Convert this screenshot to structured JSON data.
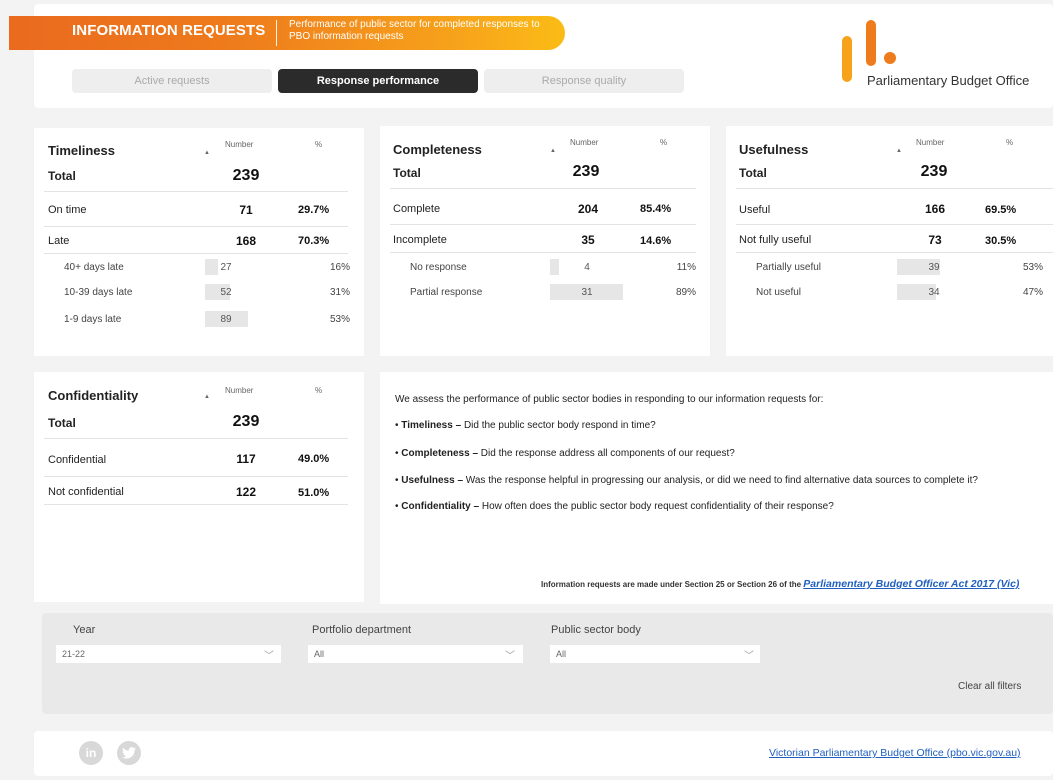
{
  "header": {
    "title": "INFORMATION REQUESTS",
    "subtitle": "Performance of public sector for completed responses to PBO information requests",
    "logo_text": "Parliamentary Budget Office",
    "brand_colors": {
      "orange": "#ee7b1c",
      "amber": "#f7a21b"
    }
  },
  "tabs": [
    {
      "label": "Active requests",
      "active": false
    },
    {
      "label": "Response performance",
      "active": true
    },
    {
      "label": "Response quality",
      "active": false
    }
  ],
  "col_headers": {
    "number": "Number",
    "percent": "%"
  },
  "timeliness": {
    "title": "Timeliness",
    "total_label": "Total",
    "total": "239",
    "rows": [
      {
        "label": "On time",
        "number": "71",
        "pct": "29.7%"
      },
      {
        "label": "Late",
        "number": "168",
        "pct": "70.3%"
      }
    ],
    "subrows": [
      {
        "label": "40+ days late",
        "number": "27",
        "pct": "16%",
        "share": 0.16
      },
      {
        "label": "10-39 days late",
        "number": "52",
        "pct": "31%",
        "share": 0.31
      },
      {
        "label": "1-9 days late",
        "number": "89",
        "pct": "53%",
        "share": 0.53
      }
    ]
  },
  "completeness": {
    "title": "Completeness",
    "total_label": "Total",
    "total": "239",
    "rows": [
      {
        "label": "Complete",
        "number": "204",
        "pct": "85.4%"
      },
      {
        "label": "Incomplete",
        "number": "35",
        "pct": "14.6%"
      }
    ],
    "subrows": [
      {
        "label": "No response",
        "number": "4",
        "pct": "11%",
        "share": 0.11
      },
      {
        "label": "Partial response",
        "number": "31",
        "pct": "89%",
        "share": 0.89
      }
    ]
  },
  "usefulness": {
    "title": "Usefulness",
    "total_label": "Total",
    "total": "239",
    "rows": [
      {
        "label": "Useful",
        "number": "166",
        "pct": "69.5%"
      },
      {
        "label": "Not fully useful",
        "number": "73",
        "pct": "30.5%"
      }
    ],
    "subrows": [
      {
        "label": "Partially useful",
        "number": "39",
        "pct": "53%",
        "share": 0.53
      },
      {
        "label": "Not useful",
        "number": "34",
        "pct": "47%",
        "share": 0.47
      }
    ]
  },
  "confidentiality": {
    "title": "Confidentiality",
    "total_label": "Total",
    "total": "239",
    "rows": [
      {
        "label": "Confidential",
        "number": "117",
        "pct": "49.0%"
      },
      {
        "label": "Not confidential",
        "number": "122",
        "pct": "51.0%"
      }
    ]
  },
  "description": {
    "intro": "We assess the performance of public sector bodies in responding to our information requests for:",
    "items": [
      {
        "term": "Timeliness",
        "text": "Did the public sector body respond in time?"
      },
      {
        "term": "Completeness",
        "text": "Did the response address all components of our request?"
      },
      {
        "term": "Usefulness",
        "text": "Was the response helpful in progressing our analysis, or did we need to find alternative data sources to complete it?"
      },
      {
        "term": "Confidentiality",
        "text": "How often does the public sector body request confidentiality of their response?"
      }
    ],
    "bullet": "•",
    "dash": "–",
    "footnote": "Information requests are made under Section 25 or Section 26 of the",
    "act_link": "Parliamentary Budget Officer Act 2017 (Vic)"
  },
  "filters": {
    "year": {
      "label": "Year",
      "value": "21-22"
    },
    "portfolio": {
      "label": "Portfolio department",
      "value": "All"
    },
    "body": {
      "label": "Public sector body",
      "value": "All"
    },
    "clear_label": "Clear all filters"
  },
  "footer": {
    "linkedin": "in",
    "link_text": "Victorian Parliamentary Budget Office (pbo.vic.gov.au)"
  }
}
